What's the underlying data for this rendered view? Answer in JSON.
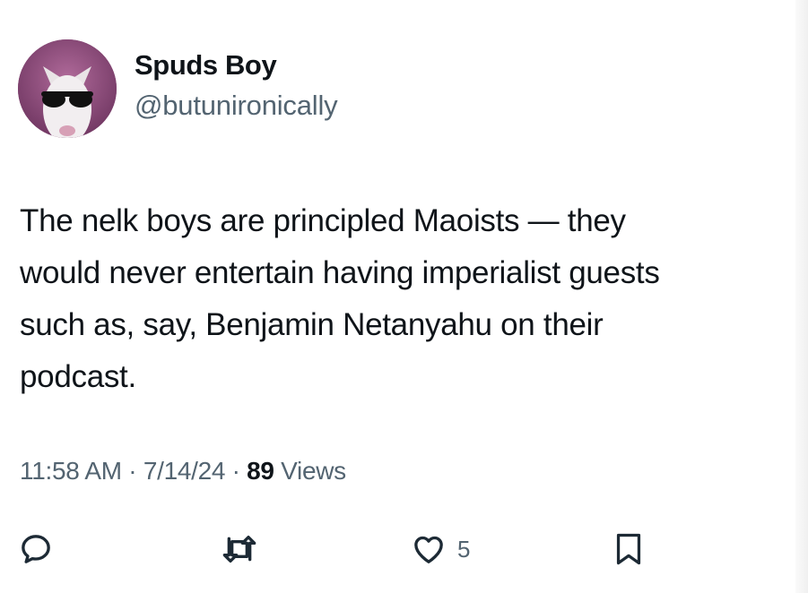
{
  "tweet": {
    "author": {
      "display_name": "Spuds Boy",
      "handle": "@butunironically",
      "avatar_icon": "bull-terrier-sunglasses-avatar"
    },
    "text": "The nelk boys are principled Maoists — they\nwould never entertain having imperialist guests\nsuch as, say, Benjamin Netanyahu on their\npodcast.",
    "meta": {
      "time": "11:58 AM",
      "sep1": " · ",
      "date": "7/14/24",
      "sep2": " · ",
      "views_count": "89",
      "views_label": " Views"
    },
    "actions": {
      "reply_icon": "reply-icon",
      "retweet_icon": "retweet-icon",
      "like_icon": "heart-icon",
      "like_count": "5",
      "bookmark_icon": "bookmark-icon"
    }
  },
  "colors": {
    "text_primary": "#0f1419",
    "text_secondary": "#536471",
    "avatar_bg": "#8a4b78"
  }
}
